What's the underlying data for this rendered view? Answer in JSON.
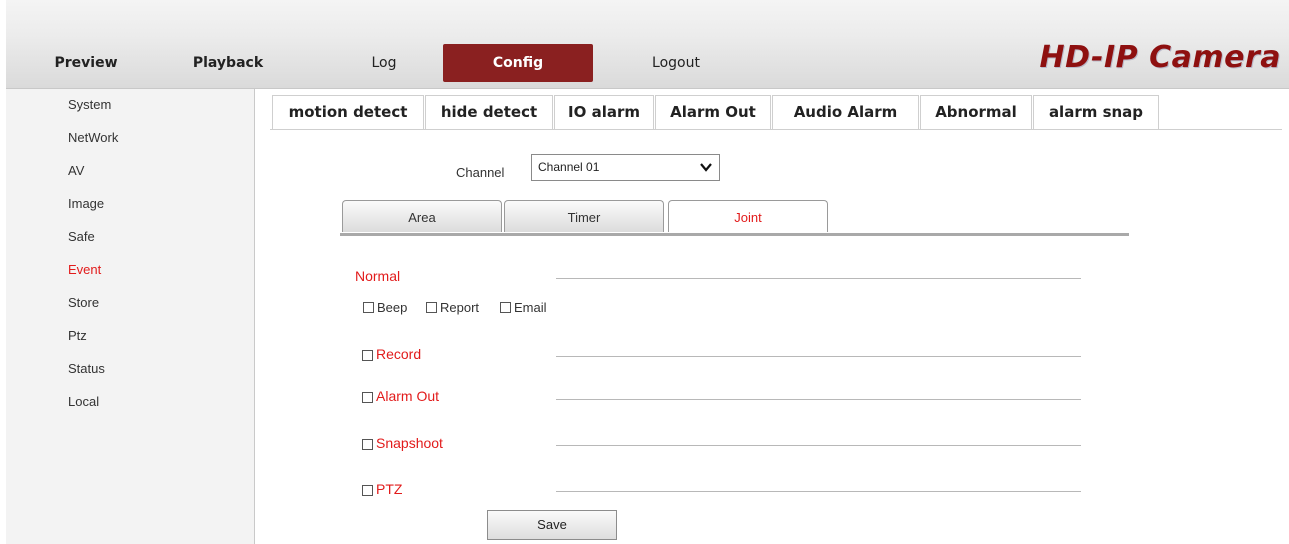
{
  "nav": {
    "preview": "Preview",
    "playback": "Playback",
    "log": "Log",
    "config": "Config",
    "logout": "Logout",
    "brand": "HD-IP Camera"
  },
  "sidebar": {
    "items": [
      {
        "label": "System"
      },
      {
        "label": "NetWork"
      },
      {
        "label": "AV"
      },
      {
        "label": "Image"
      },
      {
        "label": "Safe"
      },
      {
        "label": "Event"
      },
      {
        "label": "Store"
      },
      {
        "label": "Ptz"
      },
      {
        "label": "Status"
      },
      {
        "label": "Local"
      }
    ],
    "active": "Event"
  },
  "tabs": [
    {
      "label": "motion detect"
    },
    {
      "label": "hide detect"
    },
    {
      "label": "IO alarm"
    },
    {
      "label": "Alarm Out"
    },
    {
      "label": "Audio Alarm"
    },
    {
      "label": "Abnormal"
    },
    {
      "label": "alarm snap"
    }
  ],
  "channel": {
    "label": "Channel",
    "value": "Channel 01"
  },
  "subtabs": [
    {
      "label": "Area"
    },
    {
      "label": "Timer"
    },
    {
      "label": "Joint"
    }
  ],
  "joint": {
    "normal_title": "Normal",
    "beep": "Beep",
    "report": "Report",
    "email": "Email",
    "record": "Record",
    "alarm_out": "Alarm Out",
    "snapshoot": "Snapshoot",
    "ptz": "PTZ"
  },
  "save_label": "Save",
  "colors": {
    "accent_red": "#e21b1b",
    "config_tab": "#8a2020",
    "brand": "#8e1010"
  },
  "icons": {
    "select_arrow": "chevron-down-icon"
  }
}
